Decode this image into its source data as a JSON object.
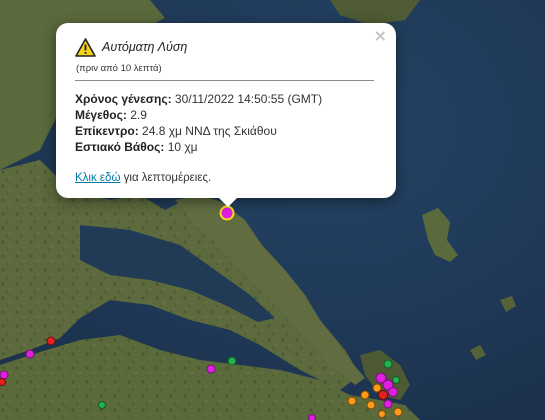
{
  "popup": {
    "title": "Αυτόματη Λύση",
    "subtitle": "(πριν από 10 λεπτά)",
    "close_label": "×",
    "origin_time_label": "Χρόνος γένεσης:",
    "origin_time_value": "30/11/2022 14:50:55 (GMT)",
    "magnitude_label": "Μέγεθος:",
    "magnitude_value": "2.9",
    "epicenter_label": "Επίκεντρο:",
    "epicenter_value": "24.8 χμ ΝΝΔ της Σκιάθου",
    "depth_label": "Εστιακό Βάθος:",
    "depth_value": "10 χμ",
    "link_text": "Κλικ εδώ",
    "link_suffix": "για λεπτομέρειες."
  },
  "colors": {
    "sea": "#233c59",
    "land": "#58623a",
    "magenta_marker": "#e11fe0",
    "green_marker": "#22b14c",
    "orange_marker": "#ff9a1a",
    "red_marker": "#e62020",
    "link": "#0078a8"
  },
  "markers": [
    {
      "type": "selected-event",
      "color": "magenta"
    },
    {
      "type": "event",
      "color": "magenta"
    },
    {
      "type": "event",
      "color": "green"
    },
    {
      "type": "event",
      "color": "red"
    },
    {
      "type": "event",
      "color": "orange"
    }
  ]
}
